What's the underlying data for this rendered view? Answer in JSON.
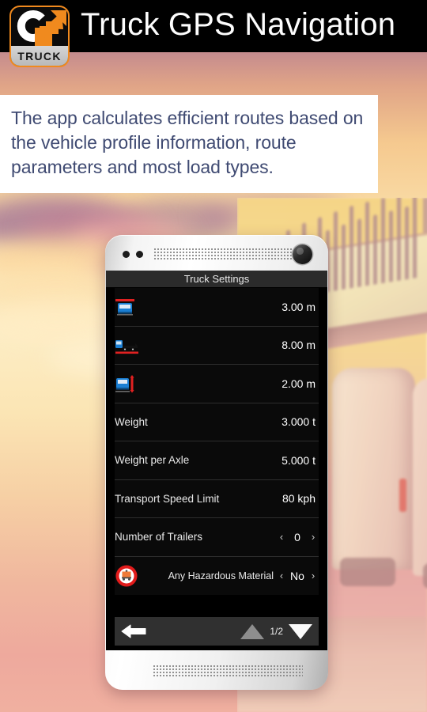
{
  "header": {
    "title": "Truck GPS Navigation",
    "app_icon_label": "TRUCK",
    "background_color": "#000000",
    "accent_color": "#f08a1e"
  },
  "description": {
    "text": "The app calculates efficient routes based on the vehicle profile information, route parameters and most load types.",
    "text_color": "#3f4a72",
    "panel_color": "#ffffff"
  },
  "phone": {
    "screen_title": "Truck Settings"
  },
  "settings": {
    "rows": [
      {
        "icon": "truck-width-icon",
        "label": "",
        "value": "3.00 m",
        "type": "value"
      },
      {
        "icon": "truck-length-icon",
        "label": "",
        "value": "8.00 m",
        "type": "value"
      },
      {
        "icon": "truck-height-icon",
        "label": "",
        "value": "2.00 m",
        "type": "value"
      },
      {
        "icon": "",
        "label": "Weight",
        "value": "3.000 t",
        "type": "value"
      },
      {
        "icon": "",
        "label": "Weight per Axle",
        "value": "5.000 t",
        "type": "value"
      },
      {
        "icon": "",
        "label": "Transport Speed Limit",
        "value": "80 kph",
        "type": "value"
      },
      {
        "icon": "",
        "label": "Number of Trailers",
        "value": "0",
        "type": "stepper"
      },
      {
        "icon": "hazmat-prohibited-icon",
        "label": "Any Hazardous Material",
        "value": "No",
        "type": "stepper"
      }
    ],
    "stepper_prev": "‹",
    "stepper_next": "›"
  },
  "toolbar": {
    "back_icon": "back-arrow-icon",
    "up_icon": "triangle-up-icon",
    "down_icon": "triangle-down-icon",
    "page_indicator": "1/2"
  }
}
